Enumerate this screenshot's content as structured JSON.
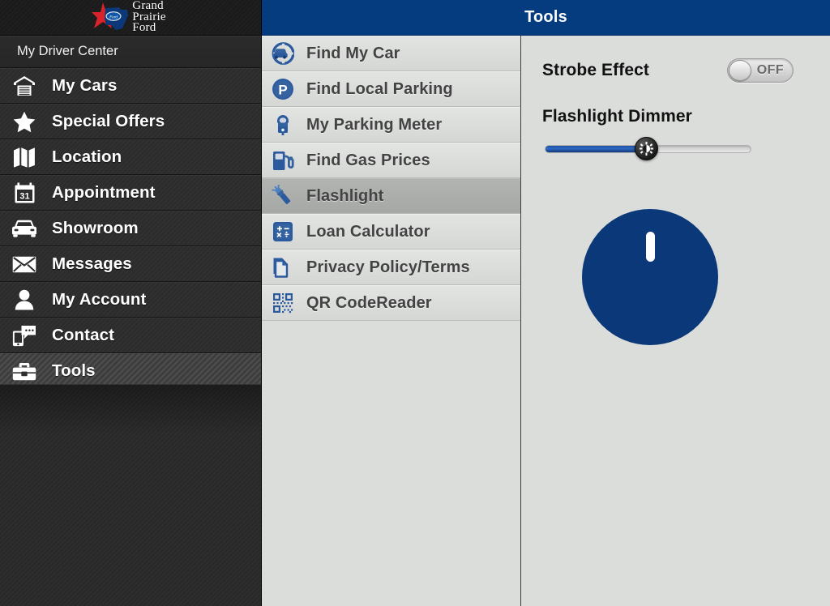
{
  "brand": {
    "logo_line1": "Grand",
    "logo_line2": "Prairie",
    "logo_line3": "Ford",
    "star_color": "#d8232a",
    "texas_color": "#0b3878"
  },
  "topbar": {
    "title": "Tools",
    "background": "#043c7f"
  },
  "sidebar": {
    "section_label": "My Driver Center",
    "items": [
      {
        "label": "My Cars",
        "icon": "garage-icon",
        "selected": false
      },
      {
        "label": "Special Offers",
        "icon": "star-icon",
        "selected": false
      },
      {
        "label": "Location",
        "icon": "map-icon",
        "selected": false
      },
      {
        "label": "Appointment",
        "icon": "calendar-icon",
        "selected": false
      },
      {
        "label": "Showroom",
        "icon": "car-front-icon",
        "selected": false
      },
      {
        "label": "Messages",
        "icon": "envelope-icon",
        "selected": false
      },
      {
        "label": "My Account",
        "icon": "person-icon",
        "selected": false
      },
      {
        "label": "Contact",
        "icon": "phone-chat-icon",
        "selected": false
      },
      {
        "label": "Tools",
        "icon": "toolbox-icon",
        "selected": true
      }
    ]
  },
  "tools_list": {
    "items": [
      {
        "label": "Find My Car",
        "icon": "compass-car-icon",
        "selected": false
      },
      {
        "label": "Find Local Parking",
        "icon": "parking-p-icon",
        "selected": false
      },
      {
        "label": "My Parking Meter",
        "icon": "parking-meter-icon",
        "selected": false
      },
      {
        "label": "Find Gas Prices",
        "icon": "gas-pump-icon",
        "selected": false
      },
      {
        "label": "Flashlight",
        "icon": "flashlight-icon",
        "selected": true
      },
      {
        "label": "Loan Calculator",
        "icon": "calculator-icon",
        "selected": false
      },
      {
        "label": "Privacy Policy/Terms",
        "icon": "documents-icon",
        "selected": false
      },
      {
        "label": "QR CodeReader",
        "icon": "qr-code-icon",
        "selected": false
      }
    ]
  },
  "detail": {
    "strobe_label": "Strobe Effect",
    "strobe_state": "OFF",
    "strobe_on": false,
    "dimmer_label": "Flashlight Dimmer",
    "dimmer_percent": 49,
    "power_button_name": "flashlight-power-button",
    "power_color": "#0b3878"
  }
}
